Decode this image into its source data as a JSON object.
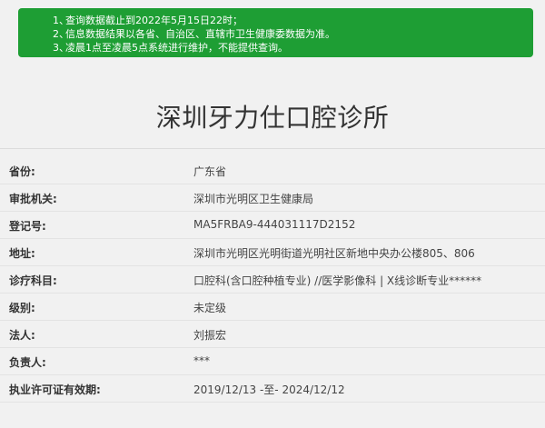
{
  "notice": {
    "items": [
      {
        "num": "1、",
        "text": "查询数据截止到2022年5月15日22时；"
      },
      {
        "num": "2、",
        "text": "信息数据结果以各省、自治区、直辖市卫生健康委数据为准。"
      },
      {
        "num": "3、",
        "text": "凌晨1点至凌晨5点系统进行维护，不能提供查询。"
      }
    ]
  },
  "title": "深圳牙力仕口腔诊所",
  "rows": [
    {
      "label": "省份:",
      "value": "广东省"
    },
    {
      "label": "审批机关:",
      "value": "深圳市光明区卫生健康局"
    },
    {
      "label": "登记号:",
      "value": "MA5FRBA9-444031117D2152"
    },
    {
      "label": "地址:",
      "value": "深圳市光明区光明街道光明社区新地中央办公楼805、806"
    },
    {
      "label": "诊疗科目:",
      "value": "口腔科(含口腔种植专业) //医学影像科 | X线诊断专业******"
    },
    {
      "label": "级别:",
      "value": "未定级"
    },
    {
      "label": "法人:",
      "value": "刘振宏"
    },
    {
      "label": "负责人:",
      "value": "***"
    },
    {
      "label": "执业许可证有效期:",
      "value": "2019/12/13 -至- 2024/12/12"
    }
  ],
  "colors": {
    "notice_bg": "#1e9e34",
    "page_bg": "#f1f1f1"
  }
}
